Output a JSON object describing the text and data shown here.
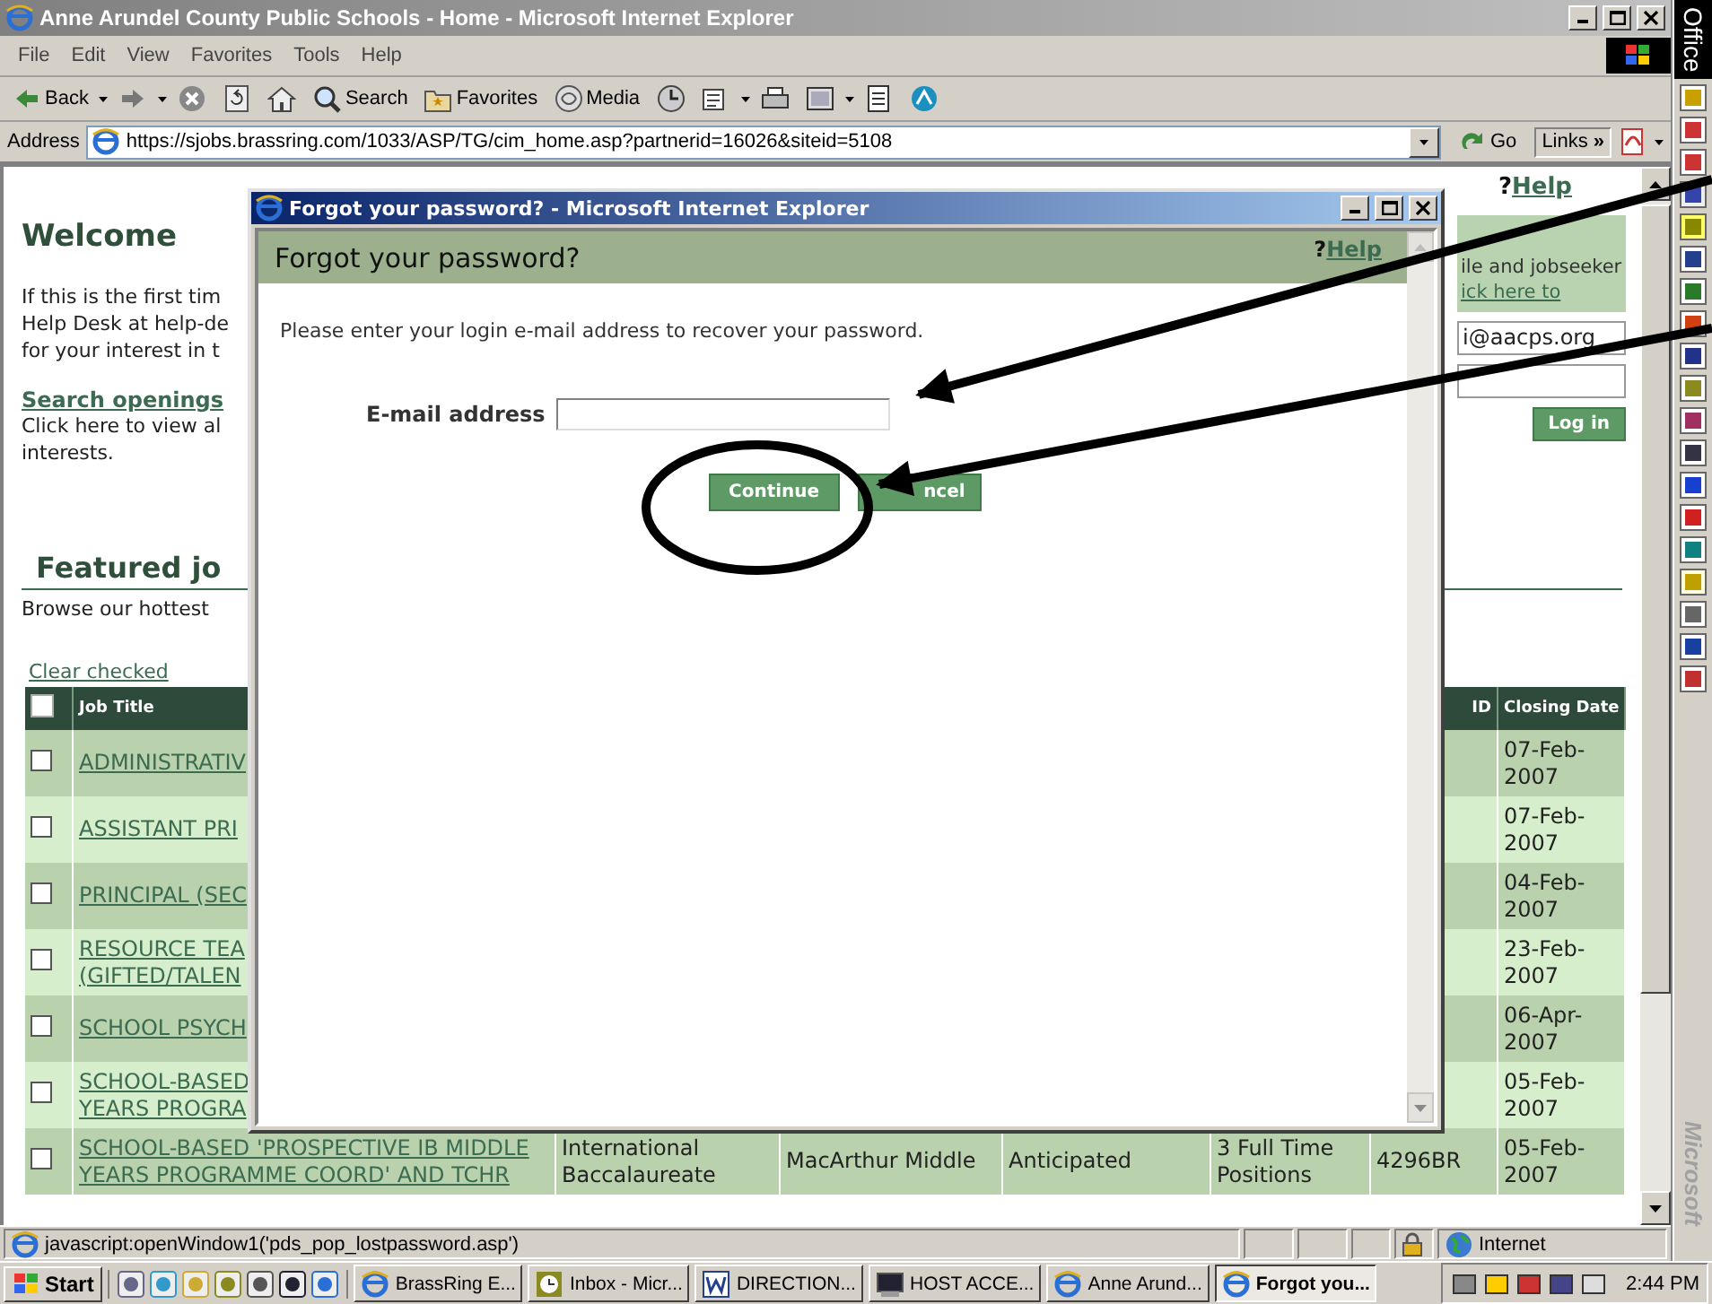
{
  "browser": {
    "title": "Anne Arundel County Public Schools - Home - Microsoft Internet Explorer",
    "menu": [
      "File",
      "Edit",
      "View",
      "Favorites",
      "Tools",
      "Help"
    ],
    "toolbar": [
      {
        "kind": "back",
        "label": "Back",
        "caret": true
      },
      {
        "kind": "forward",
        "caret": true
      },
      {
        "kind": "stop"
      },
      {
        "kind": "refresh"
      },
      {
        "kind": "home"
      },
      {
        "kind": "search",
        "label": "Search"
      },
      {
        "kind": "favorites",
        "label": "Favorites"
      },
      {
        "kind": "media",
        "label": "Media"
      },
      {
        "kind": "history"
      },
      {
        "kind": "mail",
        "caret": true
      },
      {
        "kind": "print"
      },
      {
        "kind": "edit",
        "caret": true
      },
      {
        "kind": "discuss"
      },
      {
        "kind": "messenger"
      }
    ],
    "address": {
      "label": "Address",
      "url": "https://sjobs.brassring.com/1033/ASP/TG/cim_home.asp?partnerid=16026&siteid=5108",
      "go": "Go",
      "links": "Links",
      "chevron": "»"
    }
  },
  "page": {
    "help_mark": "?",
    "help": "Help",
    "welcome": "Welcome",
    "intro_lines": [
      "If this is the first tim",
      "Help Desk at help-de",
      "for your interest in t"
    ],
    "search_link": "Search openings",
    "search_lines": [
      "Click here to view al",
      "interests."
    ],
    "login": {
      "text": "ile and jobseeker",
      "link": "ick here to",
      "email_value": "i@aacps.org",
      "button": "Log in"
    },
    "featured": "Featured jo",
    "browse": "Browse our hottest",
    "clear_checked": "Clear checked",
    "table": {
      "header_checked": false,
      "columns": [
        "Job Title",
        "",
        "",
        "",
        "",
        "ID",
        "Closing Date"
      ],
      "rows": [
        {
          "checked": false,
          "title": [
            "ADMINISTRATIV"
          ],
          "cells": [],
          "closing": "07-Feb-2007"
        },
        {
          "checked": false,
          "title": [
            "ASSISTANT PRI"
          ],
          "cells": [],
          "closing": "07-Feb-2007"
        },
        {
          "checked": false,
          "title": [
            "PRINCIPAL (SEC"
          ],
          "cells": [],
          "closing": "04-Feb-2007"
        },
        {
          "checked": false,
          "title": [
            "RESOURCE TEA",
            "(GIFTED/TALEN"
          ],
          "cells": [],
          "closing": "23-Feb-2007"
        },
        {
          "checked": false,
          "title": [
            "SCHOOL PSYCH"
          ],
          "cells": [],
          "closing": "06-Apr-2007"
        },
        {
          "checked": false,
          "title": [
            "SCHOOL-BASED",
            "YEARS PROGRA"
          ],
          "cells": [],
          "closing": "05-Feb-2007"
        },
        {
          "checked": false,
          "title": [
            "SCHOOL-BASED 'PROSPECTIVE IB MIDDLE",
            "YEARS PROGRAMME COORD' AND TCHR"
          ],
          "cells": [
            "International Baccalaureate",
            "MacArthur Middle",
            "Anticipated",
            "3 Full Time Positions",
            "4296BR"
          ],
          "closing": "05-Feb-2007"
        }
      ]
    }
  },
  "dialog": {
    "title": "Forgot your password? - Microsoft Internet Explorer",
    "heading": "Forgot your password?",
    "help_mark": "?",
    "help": "Help",
    "instructions": "Please enter your login e-mail address to recover your password.",
    "field_label": "E-mail address",
    "buttons": [
      "Continue",
      "ncel"
    ]
  },
  "status_bar": {
    "text": "javascript:openWindow1('pds_pop_lostpassword.asp')",
    "zone": "Internet"
  },
  "taskbar": {
    "start": "Start",
    "tasks": [
      {
        "kind": "ie",
        "label": "BrassRing E...",
        "selected": false
      },
      {
        "kind": "outlook",
        "label": "Inbox - Micr...",
        "selected": false
      },
      {
        "kind": "word",
        "label": "DIRECTION...",
        "selected": false
      },
      {
        "kind": "host",
        "label": "HOST ACCE...",
        "selected": false
      },
      {
        "kind": "ie",
        "label": "Anne Arund...",
        "selected": false
      },
      {
        "kind": "ie",
        "label": "Forgot you...",
        "selected": true
      }
    ],
    "clock": "2:44 PM"
  },
  "office_bar": {
    "title": "Office",
    "footer": "Microsoft"
  }
}
